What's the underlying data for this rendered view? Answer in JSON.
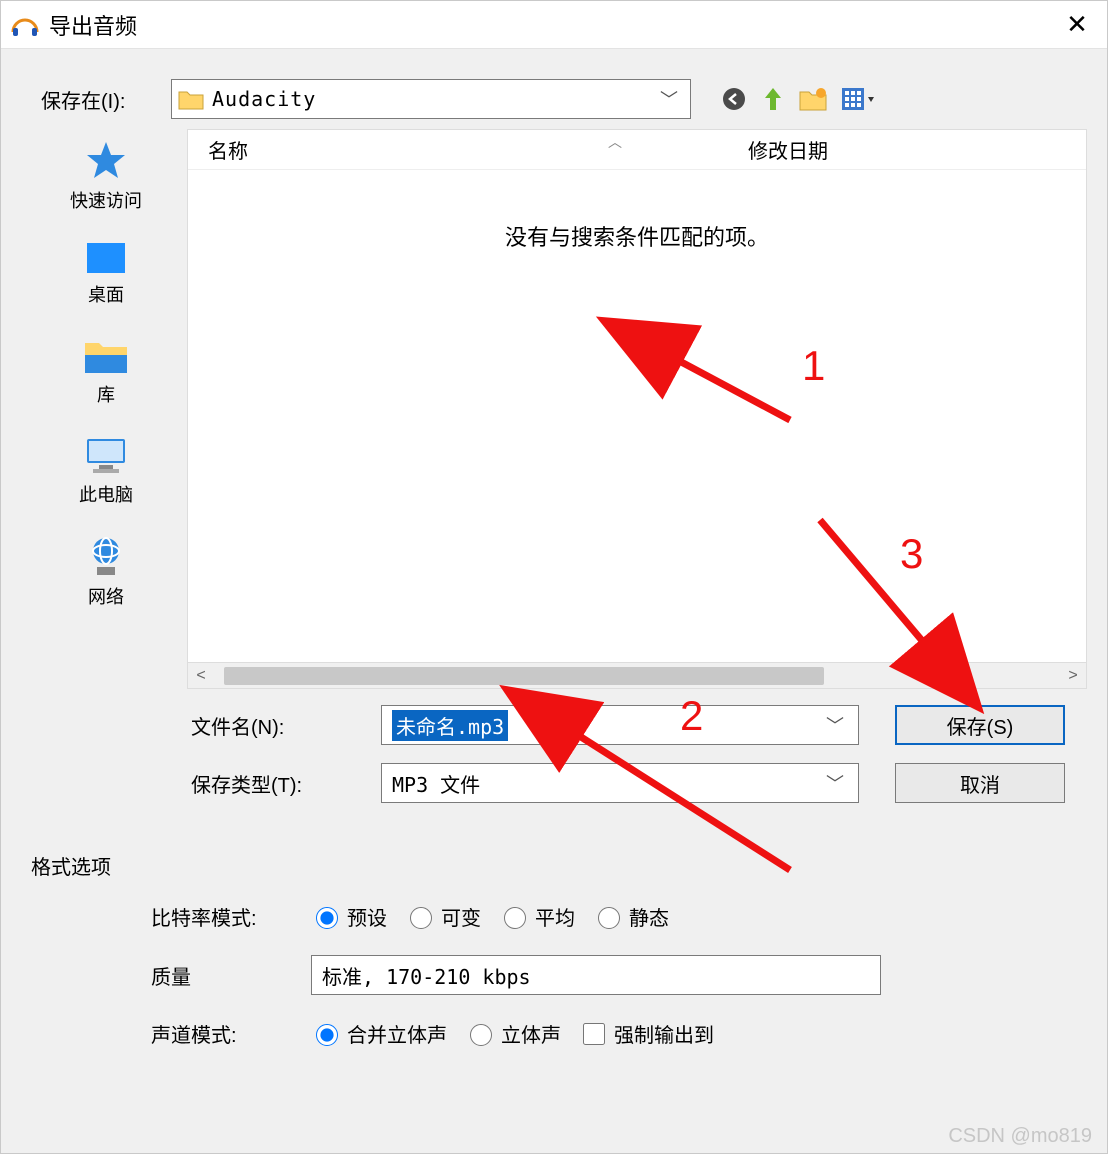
{
  "titlebar": {
    "title": "导出音频"
  },
  "savein": {
    "label": "保存在(I):",
    "folder": "Audacity"
  },
  "places": {
    "quick": "快速访问",
    "desktop": "桌面",
    "libraries": "库",
    "thispc": "此电脑",
    "network": "网络"
  },
  "list": {
    "col_name": "名称",
    "col_date": "修改日期",
    "empty": "没有与搜索条件匹配的项。"
  },
  "filename": {
    "label": "文件名(N):",
    "value": "未命名.mp3"
  },
  "savetype": {
    "label": "保存类型(T):",
    "value": "MP3 文件"
  },
  "buttons": {
    "save": "保存(S)",
    "cancel": "取消"
  },
  "section": {
    "title": "格式选项"
  },
  "bitrate": {
    "label": "比特率模式:",
    "preset": "预设",
    "variable": "可变",
    "average": "平均",
    "static": "静态"
  },
  "quality": {
    "label": "质量",
    "value": "标准, 170-210 kbps"
  },
  "channel": {
    "label": "声道模式:",
    "joint": "合并立体声",
    "stereo": "立体声",
    "force": "强制输出到"
  },
  "annotations": {
    "n1": "1",
    "n2": "2",
    "n3": "3"
  },
  "watermark": "CSDN @mo819"
}
